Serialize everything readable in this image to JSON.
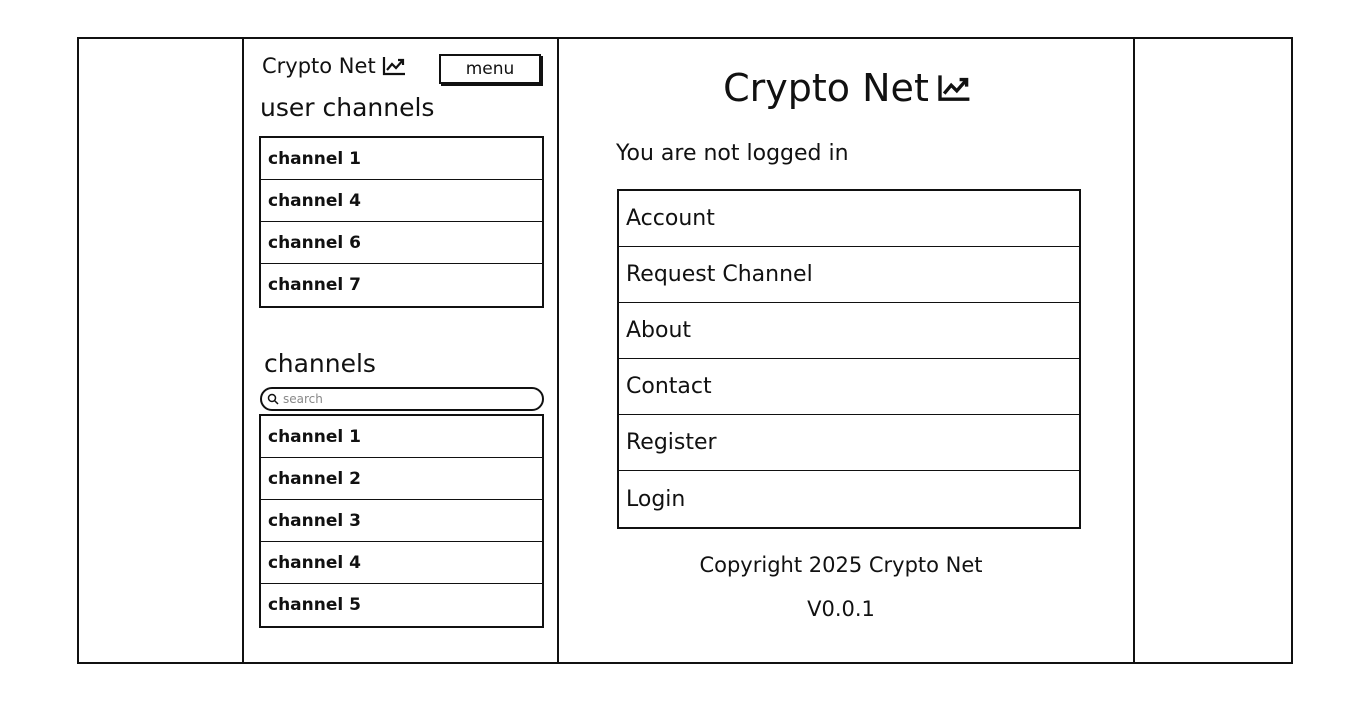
{
  "sidebar": {
    "brand": "Crypto Net",
    "brand_icon": "chart-line-icon",
    "menu_label": "menu",
    "user_channels_title": "user channels",
    "user_channels": [
      {
        "label": "channel 1"
      },
      {
        "label": "channel 4"
      },
      {
        "label": "channel 6"
      },
      {
        "label": "channel 7"
      }
    ],
    "channels_title": "channels",
    "search": {
      "placeholder": "search",
      "icon": "search-icon"
    },
    "channels": [
      {
        "label": "channel 1"
      },
      {
        "label": "channel 2"
      },
      {
        "label": "channel 3"
      },
      {
        "label": "channel 4"
      },
      {
        "label": "channel 5"
      }
    ]
  },
  "main": {
    "brand": "Crypto Net",
    "brand_icon": "chart-line-icon",
    "status": "You are not logged in",
    "nav": [
      {
        "label": "Account"
      },
      {
        "label": "Request Channel"
      },
      {
        "label": "About"
      },
      {
        "label": "Contact"
      },
      {
        "label": "Register"
      },
      {
        "label": "Login"
      }
    ],
    "copyright": "Copyright 2025 Crypto Net",
    "version": "V0.0.1"
  }
}
